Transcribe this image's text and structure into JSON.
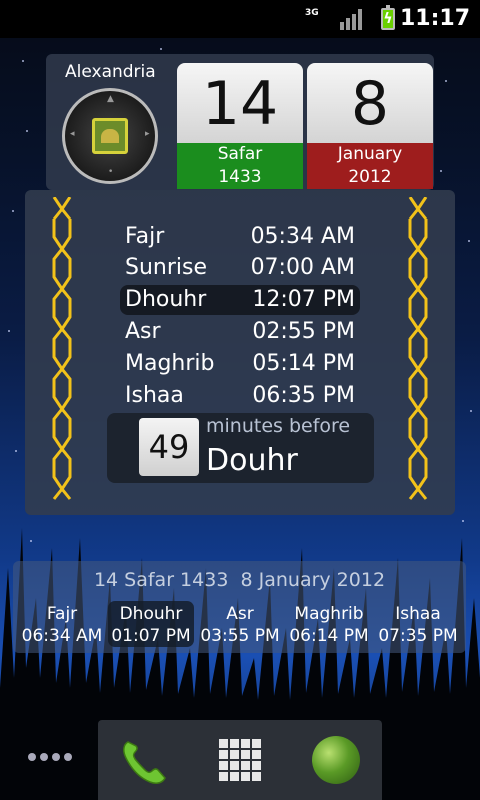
{
  "status_bar": {
    "network": "3G",
    "time": "11:17"
  },
  "location": {
    "city": "Alexandria"
  },
  "dates": {
    "hijri": {
      "day": "14",
      "month": "Safar",
      "year": "1433"
    },
    "gregorian": {
      "day": "8",
      "month": "January",
      "year": "2012"
    }
  },
  "prayer_times": [
    {
      "name": "Fajr",
      "time": "05:34 AM"
    },
    {
      "name": "Sunrise",
      "time": "07:00 AM"
    },
    {
      "name": "Dhouhr",
      "time": "12:07 PM"
    },
    {
      "name": "Asr",
      "time": "02:55 PM"
    },
    {
      "name": "Maghrib",
      "time": "05:14 PM"
    },
    {
      "name": "Ishaa",
      "time": "06:35 PM"
    }
  ],
  "countdown": {
    "value": "49",
    "label": "minutes before",
    "prayer": "Douhr"
  },
  "strip": {
    "date_line": "14 Safar 1433  8 January 2012",
    "prayers": [
      {
        "name": "Fajr",
        "time": "06:34 AM"
      },
      {
        "name": "Dhouhr",
        "time": "01:07 PM"
      },
      {
        "name": "Asr",
        "time": "03:55 PM"
      },
      {
        "name": "Maghrib",
        "time": "06:14 PM"
      },
      {
        "name": "Ishaa",
        "time": "07:35 PM"
      }
    ]
  },
  "icons": {
    "signal": "signal-bars-icon",
    "battery": "battery-charging-icon",
    "compass": "qibla-compass-icon",
    "phone": "phone-icon",
    "apps": "app-drawer-icon",
    "browser": "globe-icon"
  },
  "colors": {
    "hijri_band": "#1b8d1e",
    "gregorian_band": "#9e1d1d",
    "chain": "#f2c21a"
  }
}
